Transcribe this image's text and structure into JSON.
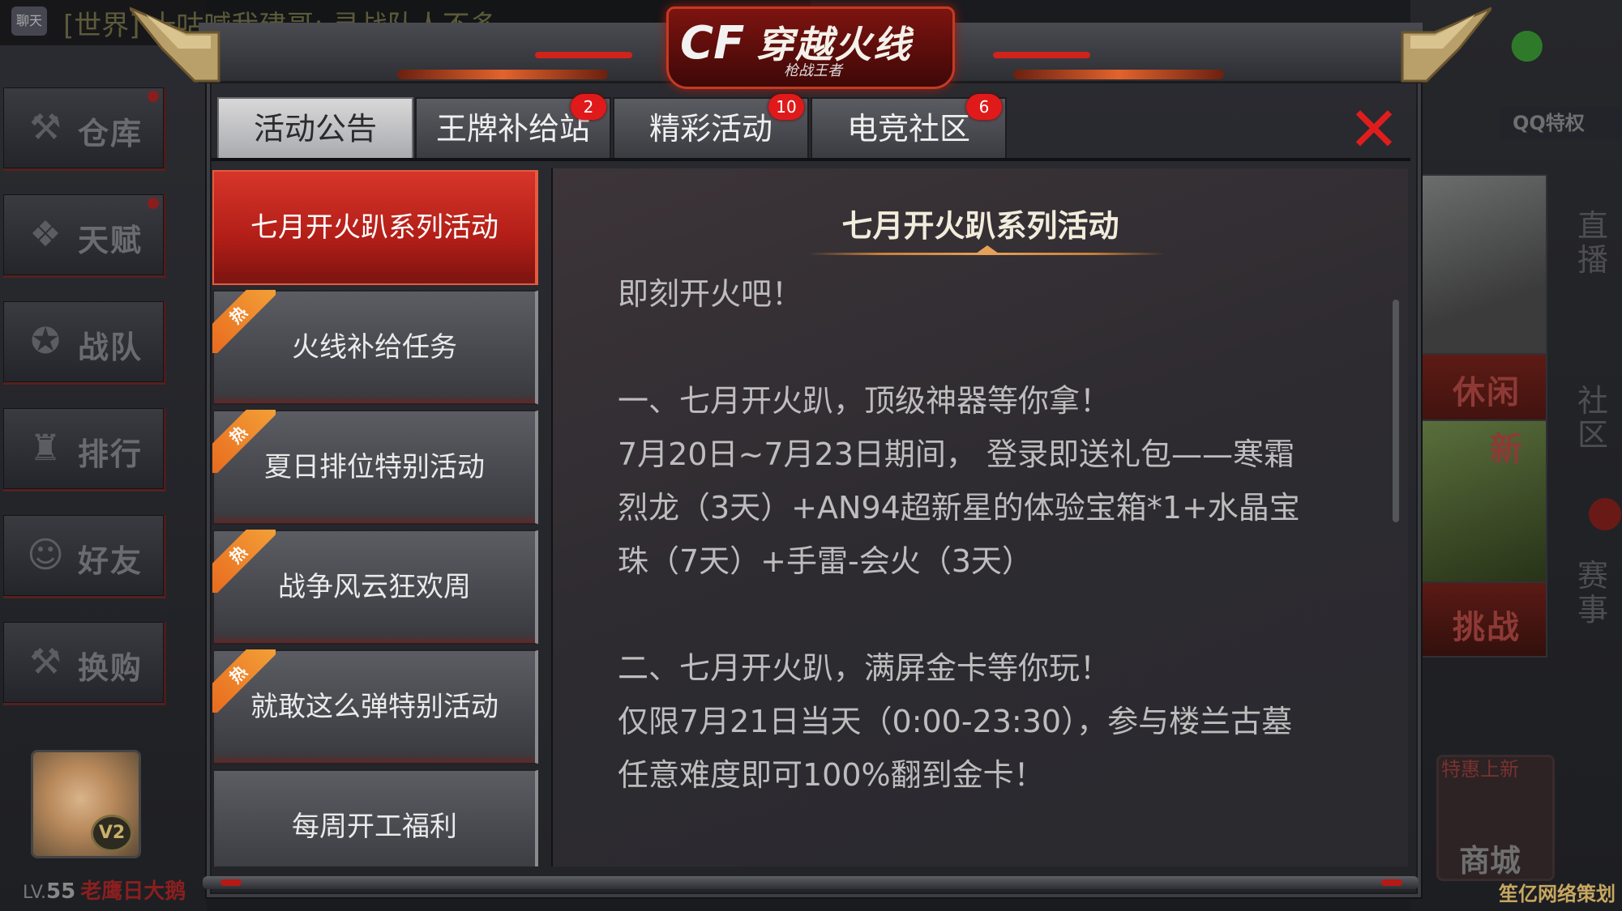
{
  "chat": {
    "icon_label": "聊天",
    "text": "[世界] 十咕喊我建哥: 寻战队人不多"
  },
  "sidebar": {
    "items": [
      {
        "label": "仓库",
        "icon": "warehouse-icon"
      },
      {
        "label": "天赋",
        "icon": "talent-icon"
      },
      {
        "label": "战队",
        "icon": "star-badge-icon"
      },
      {
        "label": "排行",
        "icon": "trophy-icon"
      },
      {
        "label": "好友",
        "icon": "friends-icon"
      },
      {
        "label": "换购",
        "icon": "tools-icon"
      }
    ]
  },
  "player": {
    "level_prefix": "LV.",
    "level": "55",
    "name": "老鹰日大鹅",
    "vip": "V2"
  },
  "right_panel": {
    "qq_label": "QQ特权",
    "tile_b_label": "休闲",
    "tile_c_label": "新",
    "tile_d_label": "挑战",
    "vertical": [
      "直播",
      "社区",
      "赛事"
    ],
    "shop_top": "特惠上新",
    "shop_label": "商城"
  },
  "dialog": {
    "logo_cf": "CF",
    "logo_title": "穿越火线",
    "logo_sub": "枪战王者",
    "close_icon": "close-x-icon",
    "tabs": [
      {
        "label": "活动公告",
        "badge": ""
      },
      {
        "label": "王牌补给站",
        "badge": "2"
      },
      {
        "label": "精彩活动",
        "badge": "10"
      },
      {
        "label": "电竞社区",
        "badge": "6"
      }
    ],
    "active_tab": 0,
    "list": [
      {
        "label": "七月开火趴系列活动",
        "hot": false
      },
      {
        "label": "火线补给任务",
        "hot": true
      },
      {
        "label": "夏日排位特别活动",
        "hot": true
      },
      {
        "label": "战争风云狂欢周",
        "hot": true
      },
      {
        "label": "就敢这么弹特别活动",
        "hot": true
      },
      {
        "label": "每周开工福利",
        "hot": false
      }
    ],
    "hot_label": "热",
    "active_item": 0,
    "content": {
      "title": "七月开火趴系列活动",
      "lines": [
        "即刻开火吧！",
        "",
        "一、七月开火趴，顶级神器等你拿！",
        "7月20日~7月23日期间， 登录即送礼包——寒霜",
        "烈龙（3天）+AN94超新星的体验宝箱*1+水晶宝",
        "珠（7天）+手雷-会火（3天）",
        "",
        "二、七月开火趴，满屏金卡等你玩！",
        "仅限7月21日当天（0:00-23:30），参与楼兰古墓",
        "任意难度即可100%翻到金卡！"
      ]
    }
  },
  "watermark": "笙亿网络策划",
  "colors": {
    "accent_red": "#e01a1a",
    "active_item": "#c2271e",
    "title_gold": "#e6a05a"
  }
}
